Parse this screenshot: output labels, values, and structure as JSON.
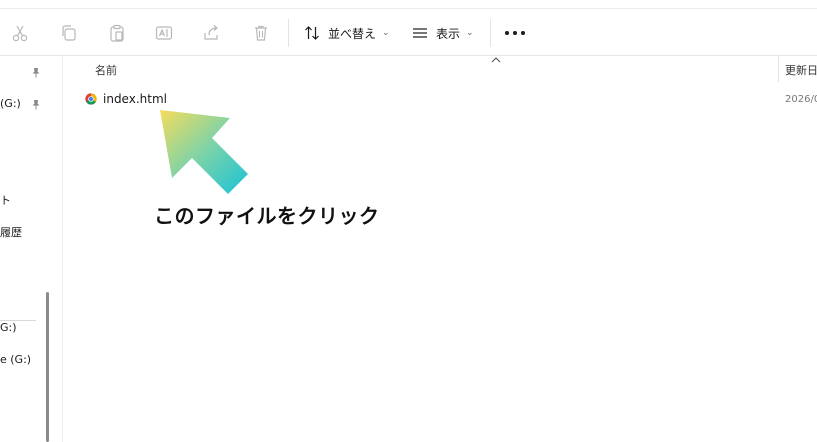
{
  "toolbar": {
    "sort_label": "並べ替え",
    "view_label": "表示",
    "sort_chevron": "⌄",
    "view_chevron": "⌄"
  },
  "nav": {
    "items": [
      {
        "label": "(G:)"
      },
      {
        "label": "ト"
      },
      {
        "label": "履歴"
      },
      {
        "label": "G:)"
      },
      {
        "label": "e (G:)"
      }
    ]
  },
  "columns": {
    "name": "名前",
    "date": "更新日"
  },
  "files": [
    {
      "name": "index.html",
      "date": "2026/0"
    }
  ],
  "annotation": {
    "text": "このファイルをクリック"
  },
  "colors": {
    "arrow_start": "#f6dc5a",
    "arrow_mid": "#7dd3a8",
    "arrow_end": "#18c2d8"
  }
}
